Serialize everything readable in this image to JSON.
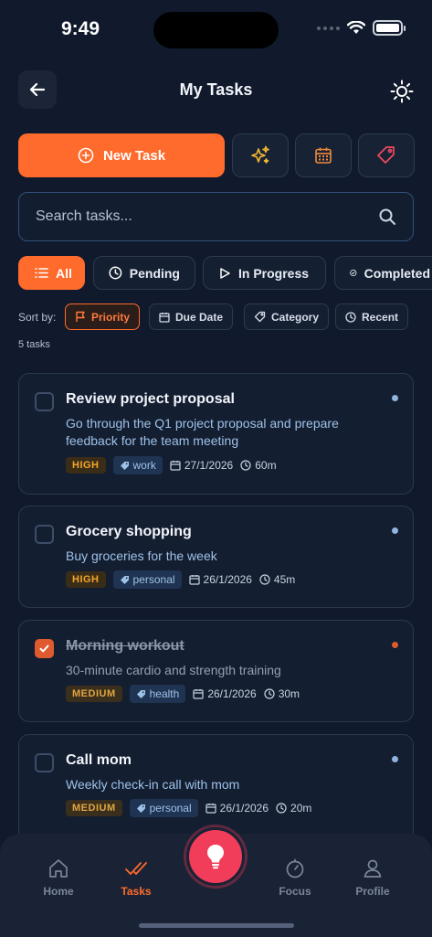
{
  "status_bar": {
    "time": "9:49"
  },
  "header": {
    "title": "My Tasks"
  },
  "actions": {
    "new_task_label": "New Task"
  },
  "search": {
    "placeholder": "Search tasks..."
  },
  "filters": [
    {
      "label": "All",
      "icon": "list-icon"
    },
    {
      "label": "Pending",
      "icon": "clock-icon"
    },
    {
      "label": "In Progress",
      "icon": "play-icon"
    },
    {
      "label": "Completed",
      "icon": "check-circle-icon"
    }
  ],
  "sort": {
    "label": "Sort by:",
    "options": [
      "Priority",
      "Due Date",
      "Category",
      "Recent"
    ],
    "count_text": "5 tasks"
  },
  "tasks": [
    {
      "title": "Review project proposal",
      "description": "Go through the Q1 project proposal and prepare feedback for the team meeting",
      "priority": "HIGH",
      "category": "work",
      "date": "27/1/2026",
      "duration": "60m",
      "completed": false,
      "dot_color": "#8fb4df"
    },
    {
      "title": "Grocery shopping",
      "description": "Buy groceries for the week",
      "priority": "HIGH",
      "category": "personal",
      "date": "26/1/2026",
      "duration": "45m",
      "completed": false,
      "dot_color": "#8fb4df"
    },
    {
      "title": "Morning workout",
      "description": "30-minute cardio and strength training",
      "priority": "MEDIUM",
      "category": "health",
      "date": "26/1/2026",
      "duration": "30m",
      "completed": true,
      "dot_color": "#e05a30"
    },
    {
      "title": "Call mom",
      "description": "Weekly check-in call with mom",
      "priority": "MEDIUM",
      "category": "personal",
      "date": "26/1/2026",
      "duration": "20m",
      "completed": false,
      "dot_color": "#8fb4df"
    }
  ],
  "nav": {
    "items": [
      "Home",
      "Tasks",
      "Focus",
      "Profile"
    ],
    "active": "Tasks"
  },
  "colors": {
    "accent": "#ff6b2c",
    "fab": "#f23d5a",
    "background": "#111a2c"
  }
}
